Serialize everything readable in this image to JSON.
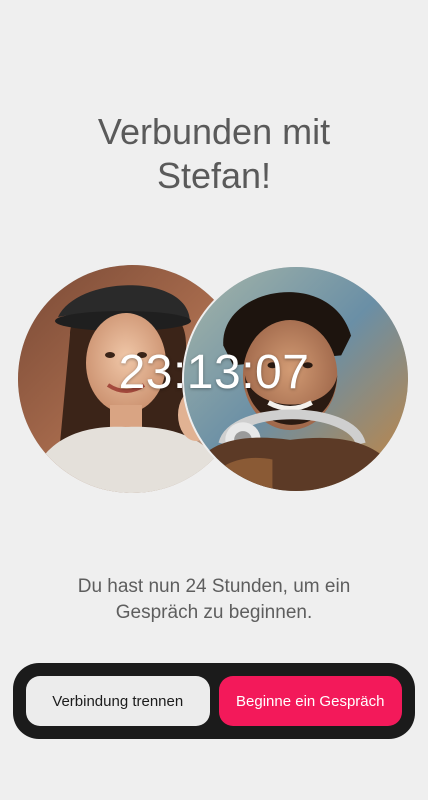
{
  "header": {
    "title_line1": "Verbunden mit",
    "title_line2": "Stefan!"
  },
  "match": {
    "timer": "23:13:07",
    "left_avatar": "woman-photo",
    "right_avatar": "man-photo"
  },
  "info_text": "Du hast nun 24 Stunden, um ein Gespräch zu beginnen.",
  "actions": {
    "disconnect_label": "Verbindung trennen",
    "start_label": "Beginne ein Gespräch"
  },
  "colors": {
    "background": "#efefef",
    "primary": "#f3195a",
    "bar": "#1b1b1b"
  }
}
